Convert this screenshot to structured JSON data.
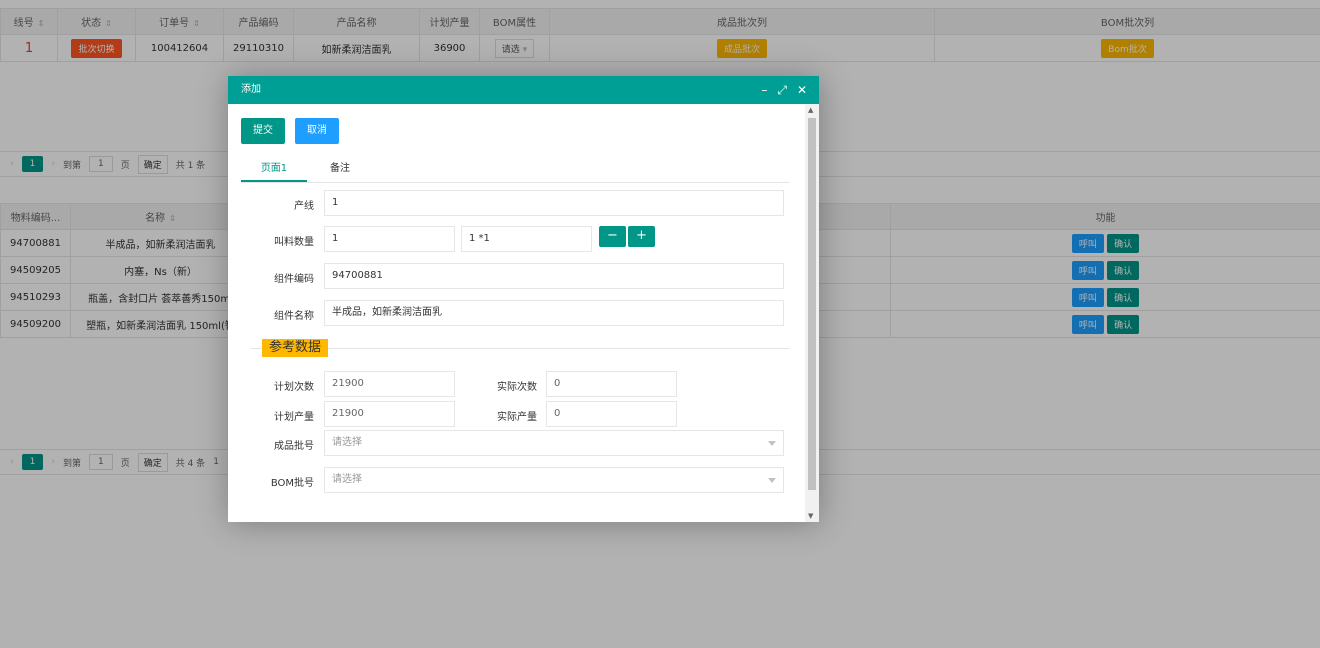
{
  "top_table": {
    "headers": [
      "线号",
      "状态",
      "订单号",
      "产品编码",
      "产品名称",
      "计划产量",
      "BOM属性",
      "成品批次列",
      "BOM批次列"
    ],
    "row": {
      "line": "1",
      "status_btn": "批次切换",
      "order": "100412604",
      "product_code": "29110310",
      "product_name": "如新柔润洁面乳",
      "plan_qty": "36900",
      "bom_select": "请选",
      "batch_btn": "成品批次",
      "bom_batch_btn": "Bom批次"
    }
  },
  "pager1": {
    "page": "1",
    "goto": "到第",
    "input": "1",
    "unit": "页",
    "confirm": "确定",
    "total": "共 1 条"
  },
  "bottom_table": {
    "headers": [
      "物料编码...",
      "名称",
      "功能"
    ],
    "rows": [
      {
        "code": "94700881",
        "name": "半成品，如新柔润洁面乳"
      },
      {
        "code": "94509205",
        "name": "内塞，Ns（新）"
      },
      {
        "code": "94510293",
        "name": "瓶盖，含封口片 荟萃善秀150ml"
      },
      {
        "code": "94509200",
        "name": "塑瓶，如新柔润洁面乳 150ml(智"
      }
    ],
    "call_btn": "呼叫",
    "confirm_btn": "确认"
  },
  "pager2": {
    "page": "1",
    "goto": "到第",
    "input": "1",
    "unit": "页",
    "confirm": "确定",
    "total": "共 4 条",
    "size": "1"
  },
  "dialog": {
    "title": "添加",
    "submit": "提交",
    "cancel": "取消",
    "tabs": [
      "页面1",
      "备注"
    ],
    "fields": {
      "line_label": "产线",
      "line_value": "1",
      "call_qty_label": "叫料数量",
      "call_qty_value": "1",
      "call_qty_expr": "1 *1",
      "minus": "−",
      "plus": "+",
      "comp_code_label": "组件编码",
      "comp_code_value": "94700881",
      "comp_name_label": "组件名称",
      "comp_name_value": "半成品，如新柔润洁面乳"
    },
    "ref_legend": "参考数据",
    "ref": {
      "plan_times_label": "计划次数",
      "plan_times_value": "21900",
      "actual_times_label": "实际次数",
      "actual_times_value": "0",
      "plan_qty_label": "计划产量",
      "plan_qty_value": "21900",
      "actual_qty_label": "实际产量",
      "actual_qty_value": "0",
      "batch_label": "成品批号",
      "batch_placeholder": "请选择",
      "bom_label": "BOM批号",
      "bom_placeholder": "请选择"
    }
  },
  "colors": {
    "teal": "#009688",
    "header_teal": "#009f95",
    "blue": "#1e9fff",
    "red": "#ff5722",
    "yellow": "#ffb800"
  }
}
